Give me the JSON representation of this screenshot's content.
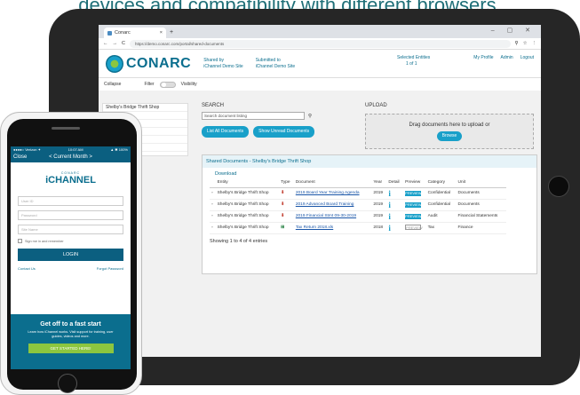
{
  "caption": "devices and compatibility with different browsers.",
  "browser": {
    "tab_title": "Conarc",
    "new_tab": "+",
    "url": "https://demo.conarc.com/portal/shared-documents",
    "window_controls": "– ▢ ✕"
  },
  "header": {
    "logo": "CONARC",
    "shared_by_label": "Shared by",
    "shared_by_value": "iChannel Demo Site",
    "submitted_to_label": "Submitted to",
    "submitted_to_value": "iChannel Demo Site",
    "selected_entities": "Selected Entities",
    "selected_count": "1 of 1",
    "my_profile": "My Profile",
    "admin": "Admin",
    "logout": "Logout"
  },
  "subbar": {
    "collapse": "Collapse",
    "filter": "Filter",
    "visibility": "Visibility"
  },
  "left_panel": {
    "items": [
      "Shelby's Bridge Thrift Shop",
      "",
      "",
      "",
      "",
      ""
    ]
  },
  "search": {
    "title": "SEARCH",
    "placeholder": "Search document listing",
    "list_all": "List All Documents",
    "show_unread": "Show Unread Documents"
  },
  "upload": {
    "title": "UPLOAD",
    "prompt": "Drag documents here to upload or",
    "browse": "Browse"
  },
  "documents": {
    "panel_title": "Shared Documents - Shelby's Bridge Thrift Shop",
    "download": "Download",
    "columns": [
      "",
      "Entity",
      "Type",
      "Document",
      "Year",
      "Detail",
      "Preview",
      "Category",
      "Unit"
    ],
    "rows": [
      {
        "entity": "Shelby's Bridge Thrift Shop",
        "type": "pdf",
        "document": "2019 Board Year Training Agenda",
        "year": "2019",
        "detail": "i",
        "preview": "PREVIEW",
        "category": "Confidential",
        "unit": "Documents"
      },
      {
        "entity": "Shelby's Bridge Thrift Shop",
        "type": "pdf",
        "document": "2019 Advanced Board Training",
        "year": "2019",
        "detail": "i",
        "preview": "PREVIEW",
        "category": "Confidential",
        "unit": "Documents"
      },
      {
        "entity": "Shelby's Bridge Thrift Shop",
        "type": "pdf",
        "document": "2019 Financial Stmt 09-30-2019",
        "year": "2019",
        "detail": "i",
        "preview": "PREVIEW",
        "category": "Audit",
        "unit": "Financial Statements"
      },
      {
        "entity": "Shelby's Bridge Thrift Shop",
        "type": "xls",
        "document": "Tax Return 2018.xls",
        "year": "2018",
        "detail": "i",
        "preview": "PREVIEW",
        "category": "Tax",
        "unit": "Finance"
      }
    ],
    "footer": "Showing 1 to 4 of 4 entries"
  },
  "phone": {
    "status_left": "●●●●○ Verizon ✦",
    "status_time": "10:07 AM",
    "status_right": "▲ ✱ 100%",
    "close": "Close",
    "nav_title": "< Current Month >",
    "brand_top": "CONARC",
    "brand": "iCHANNEL",
    "field_user": "User ID",
    "field_password": "Password",
    "field_site": "Site Name",
    "remember": "Sign me in and remember",
    "login": "LOGIN",
    "contact": "Contact Us",
    "forgot": "Forgot Password",
    "promo_title": "Get off to a fast start",
    "promo_text": "Learn how iChannel works. Visit support for training, user guides, videos and more.",
    "promo_cta": "GET STARTED HERE!"
  }
}
